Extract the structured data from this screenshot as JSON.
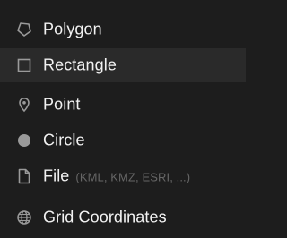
{
  "colors": {
    "background": "#1d1d1d",
    "highlight": "#2a2a2a",
    "text": "#f2f2f2",
    "hint": "#666666",
    "icon": "#9a9a9a"
  },
  "menu": {
    "items": [
      {
        "label": "Polygon",
        "icon": "polygon-icon"
      },
      {
        "label": "Rectangle",
        "icon": "rectangle-icon",
        "highlighted": true
      },
      {
        "label": "Point",
        "icon": "map-pin-icon"
      },
      {
        "label": "Circle",
        "icon": "circle-icon"
      },
      {
        "label": "File",
        "hint": "(KML, KMZ, ESRI, ...)",
        "icon": "file-icon"
      },
      {
        "label": "Grid Coordinates",
        "icon": "globe-grid-icon"
      }
    ]
  }
}
